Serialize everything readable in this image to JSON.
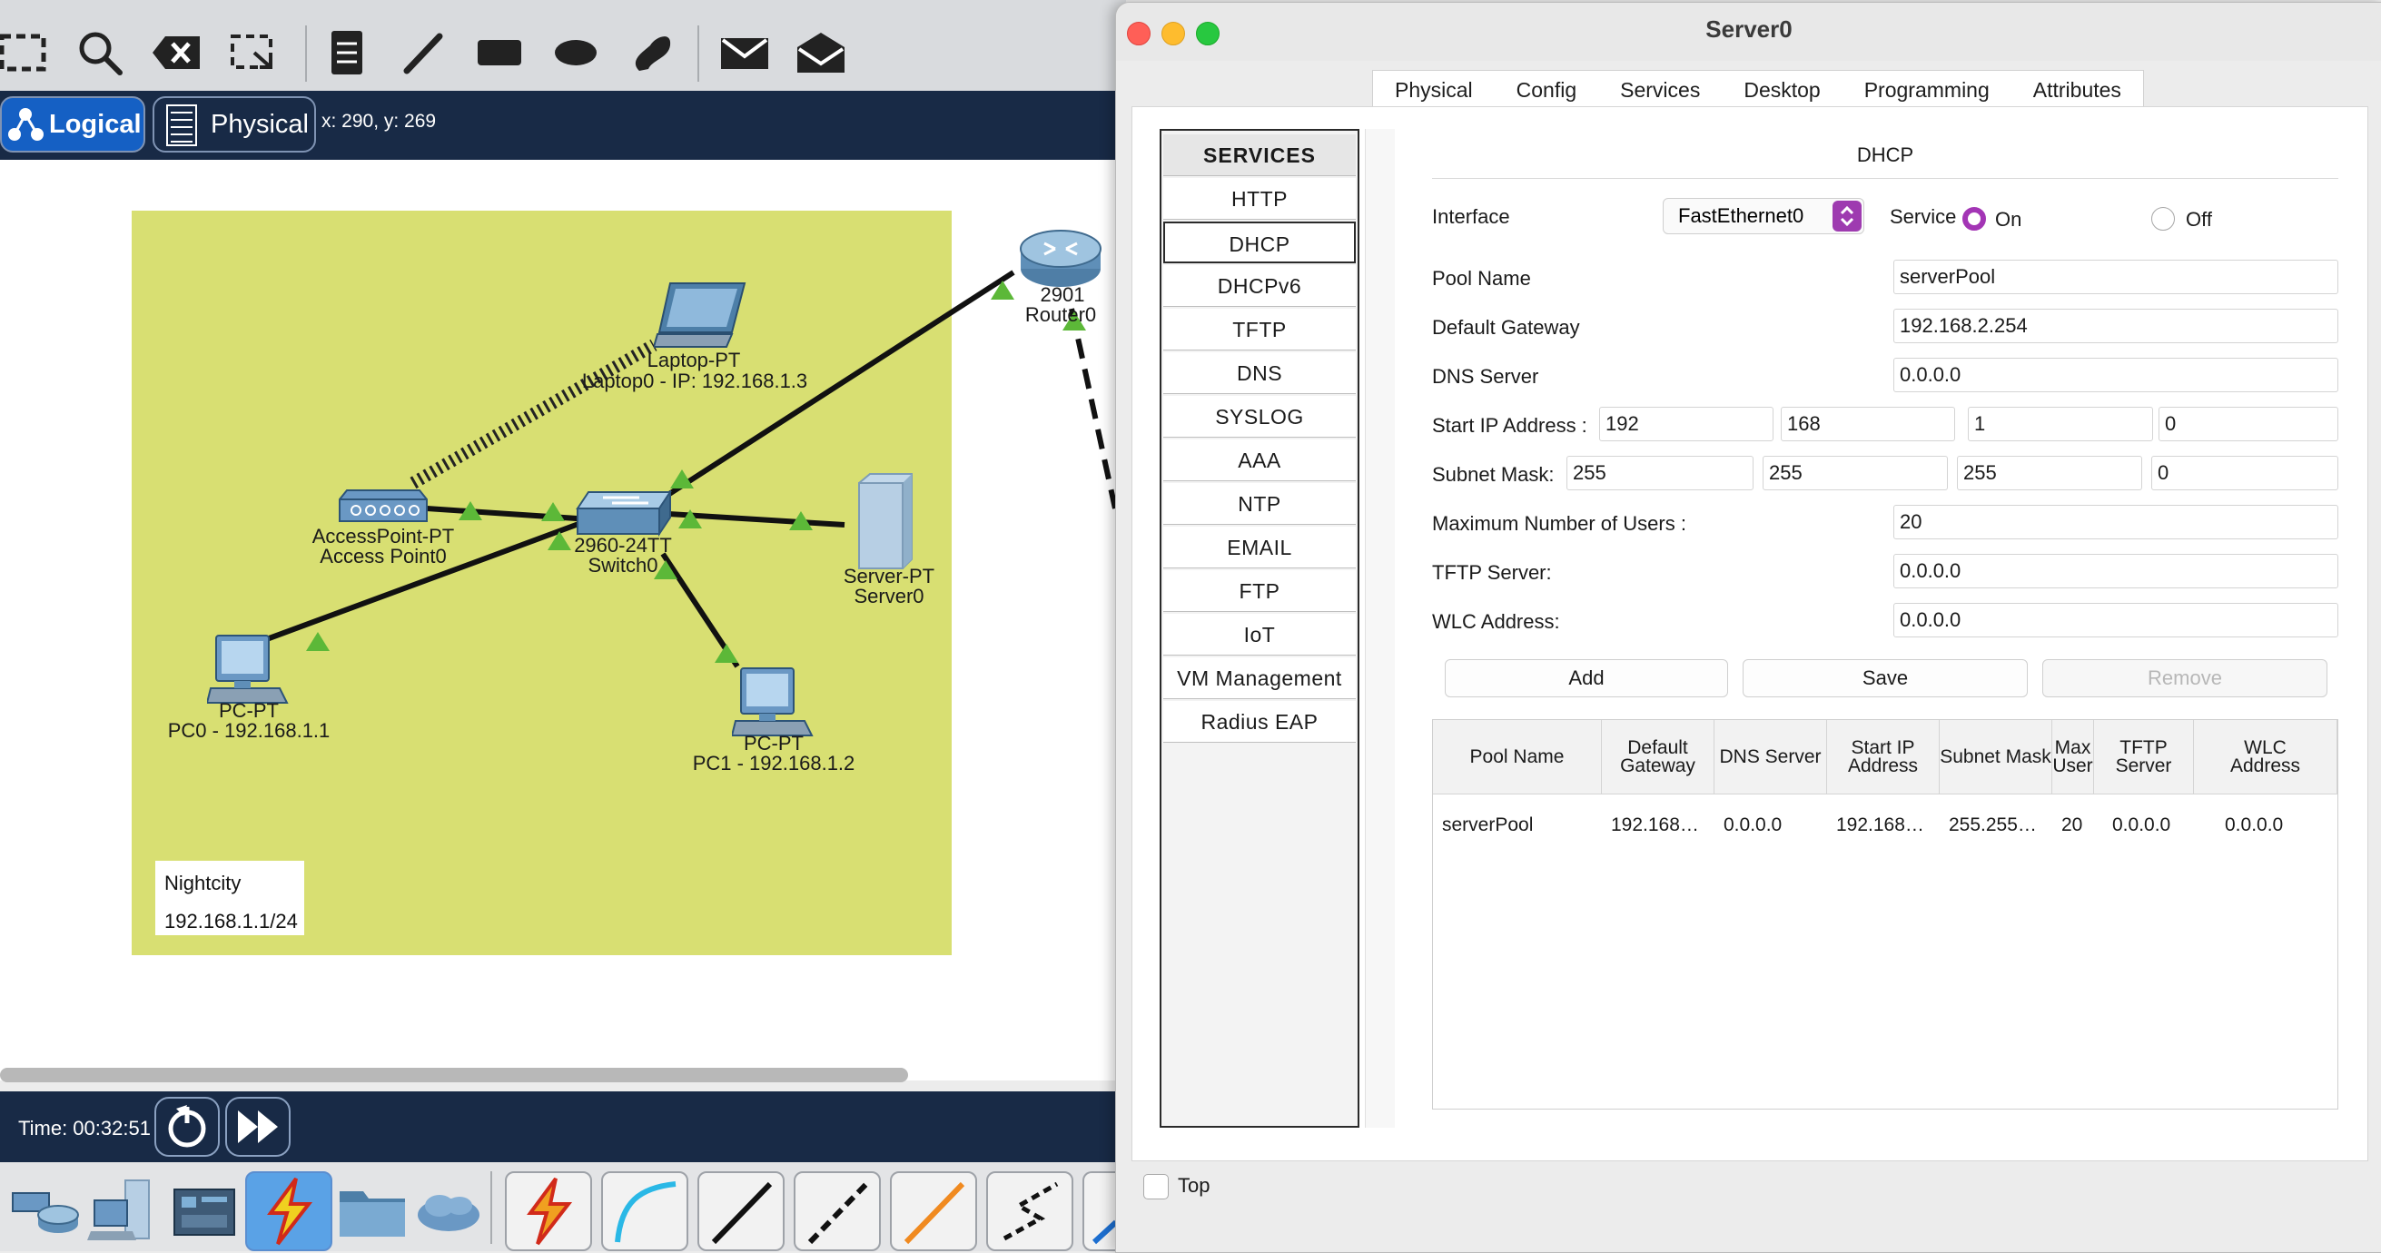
{
  "workspace": {
    "modes": {
      "logical": "Logical",
      "physical": "Physical"
    },
    "coords": "x: 290, y: 269",
    "time": "Time: 00:32:51"
  },
  "topology": {
    "laptop": {
      "type": "Laptop-PT",
      "name": "Laptop0 - IP: 192.168.1.3"
    },
    "router": {
      "type": "2901",
      "name": "Router0"
    },
    "access_point": {
      "type": "AccessPoint-PT",
      "name": "Access Point0"
    },
    "switch": {
      "type": "2960-24TT",
      "name": "Switch0"
    },
    "server": {
      "type": "Server-PT",
      "name": "Server0"
    },
    "pc0": {
      "type": "PC-PT",
      "name": "PC0 - 192.168.1.1"
    },
    "pc1": {
      "type": "PC-PT",
      "name": "PC1 - 192.168.1.2"
    },
    "note": {
      "line1": "Nightcity",
      "line2": "192.168.1.1/24"
    },
    "cluster_color": "#d8df72",
    "link_up_color": "#5cb838"
  },
  "dialog": {
    "title": "Server0",
    "tabs": [
      "Physical",
      "Config",
      "Services",
      "Desktop",
      "Programming",
      "Attributes"
    ],
    "active_tab": "Services",
    "services_header": "SERVICES",
    "services": [
      "HTTP",
      "DHCP",
      "DHCPv6",
      "TFTP",
      "DNS",
      "SYSLOG",
      "AAA",
      "NTP",
      "EMAIL",
      "FTP",
      "IoT",
      "VM Management",
      "Radius EAP"
    ],
    "selected_service": "DHCP",
    "top_label": "Top"
  },
  "dhcp": {
    "title": "DHCP",
    "interface_label": "Interface",
    "interface_value": "FastEthernet0",
    "service_label": "Service",
    "on_label": "On",
    "off_label": "Off",
    "service_state": "On",
    "pool_name_label": "Pool Name",
    "pool_name": "serverPool",
    "gateway_label": "Default Gateway",
    "gateway": "192.168.2.254",
    "dns_label": "DNS Server",
    "dns": "0.0.0.0",
    "start_ip_label": "Start IP Address :",
    "start_ip": [
      "192",
      "168",
      "1",
      "0"
    ],
    "mask_label": "Subnet Mask:",
    "mask": [
      "255",
      "255",
      "255",
      "0"
    ],
    "max_users_label": "Maximum Number of Users :",
    "max_users": "20",
    "tftp_label": "TFTP Server:",
    "tftp": "0.0.0.0",
    "wlc_label": "WLC Address:",
    "wlc": "0.0.0.0",
    "buttons": {
      "add": "Add",
      "save": "Save",
      "remove": "Remove"
    },
    "accent_color": "#a335b5"
  },
  "pool_table": {
    "headers": [
      "Pool Name",
      "Default Gateway",
      "DNS Server",
      "Start IP Address",
      "Subnet Mask",
      "Max User",
      "TFTP Server",
      "WLC Address"
    ],
    "rows": [
      [
        "serverPool",
        "192.168…",
        "0.0.0.0",
        "192.168…",
        "255.255…",
        "20",
        "0.0.0.0",
        "0.0.0.0"
      ]
    ]
  }
}
